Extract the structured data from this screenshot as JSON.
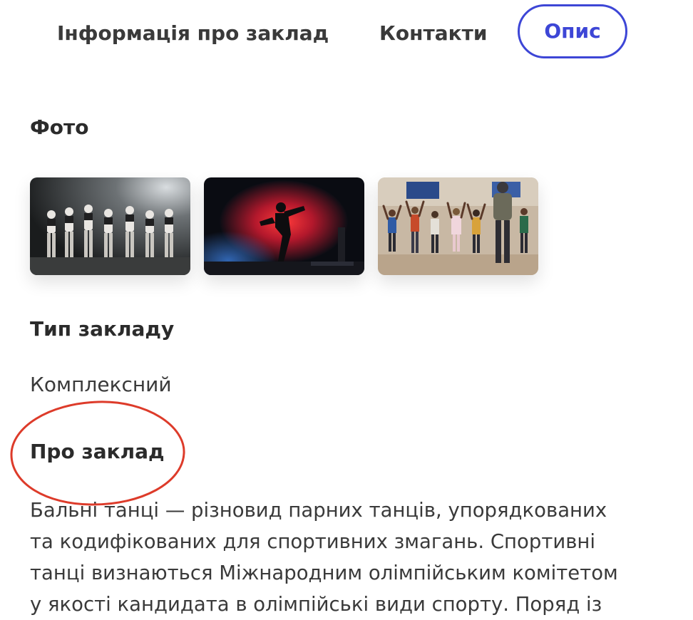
{
  "tabs": [
    {
      "label": "Інформація про заклад",
      "active": false
    },
    {
      "label": "Контакти",
      "active": false
    },
    {
      "label": "Опис",
      "active": true
    }
  ],
  "accent_color": "#3d46d6",
  "annotation_color": "#dd3b2a",
  "photos": {
    "title": "Фото",
    "items": [
      {
        "icon": "dance-group-photo"
      },
      {
        "icon": "breakdancer-stage-photo"
      },
      {
        "icon": "kids-dance-class-photo"
      }
    ]
  },
  "establishment_type": {
    "title": "Тип закладу",
    "value": "Комплексний"
  },
  "about": {
    "title": "Про заклад",
    "lines": [
      "Бальні танці — різновид парних танців, упорядкованих",
      "та кодифікованих для спортивних змагань. Спортивні",
      "танці визнаються Міжнародним олімпійським комітетом",
      "у якості кандидата в олімпійські види спорту. Поряд із"
    ]
  }
}
